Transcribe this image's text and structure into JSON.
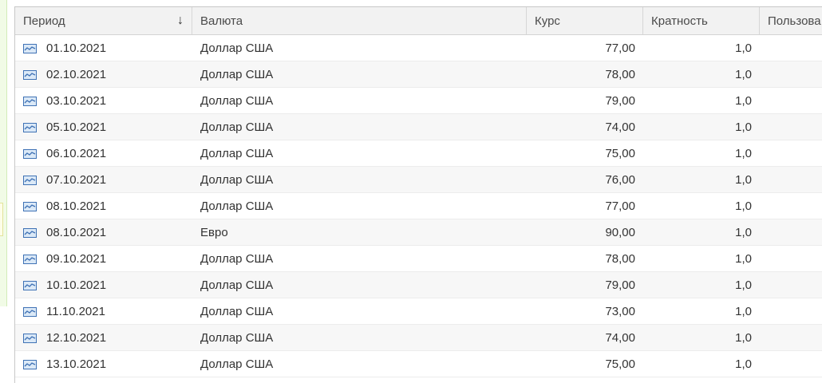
{
  "table": {
    "columns": {
      "period": "Период",
      "currency": "Валюта",
      "rate": "Курс",
      "multiplicity": "Кратность",
      "user": "Пользова"
    },
    "sort_icon": "arrow-down-icon",
    "row_icon": "register-record-icon",
    "rows": [
      {
        "period": "01.10.2021",
        "currency": "Доллар США",
        "rate": "77,00",
        "mult": "1,0"
      },
      {
        "period": "02.10.2021",
        "currency": "Доллар США",
        "rate": "78,00",
        "mult": "1,0"
      },
      {
        "period": "03.10.2021",
        "currency": "Доллар США",
        "rate": "79,00",
        "mult": "1,0"
      },
      {
        "period": "05.10.2021",
        "currency": "Доллар США",
        "rate": "74,00",
        "mult": "1,0"
      },
      {
        "period": "06.10.2021",
        "currency": "Доллар США",
        "rate": "75,00",
        "mult": "1,0"
      },
      {
        "period": "07.10.2021",
        "currency": "Доллар США",
        "rate": "76,00",
        "mult": "1,0"
      },
      {
        "period": "08.10.2021",
        "currency": "Доллар США",
        "rate": "77,00",
        "mult": "1,0"
      },
      {
        "period": "08.10.2021",
        "currency": "Евро",
        "rate": "90,00",
        "mult": "1,0"
      },
      {
        "period": "09.10.2021",
        "currency": "Доллар США",
        "rate": "78,00",
        "mult": "1,0"
      },
      {
        "period": "10.10.2021",
        "currency": "Доллар США",
        "rate": "79,00",
        "mult": "1,0"
      },
      {
        "period": "11.10.2021",
        "currency": "Доллар США",
        "rate": "73,00",
        "mult": "1,0"
      },
      {
        "period": "12.10.2021",
        "currency": "Доллар США",
        "rate": "74,00",
        "mult": "1,0"
      },
      {
        "period": "13.10.2021",
        "currency": "Доллар США",
        "rate": "75,00",
        "mult": "1,0"
      }
    ]
  }
}
